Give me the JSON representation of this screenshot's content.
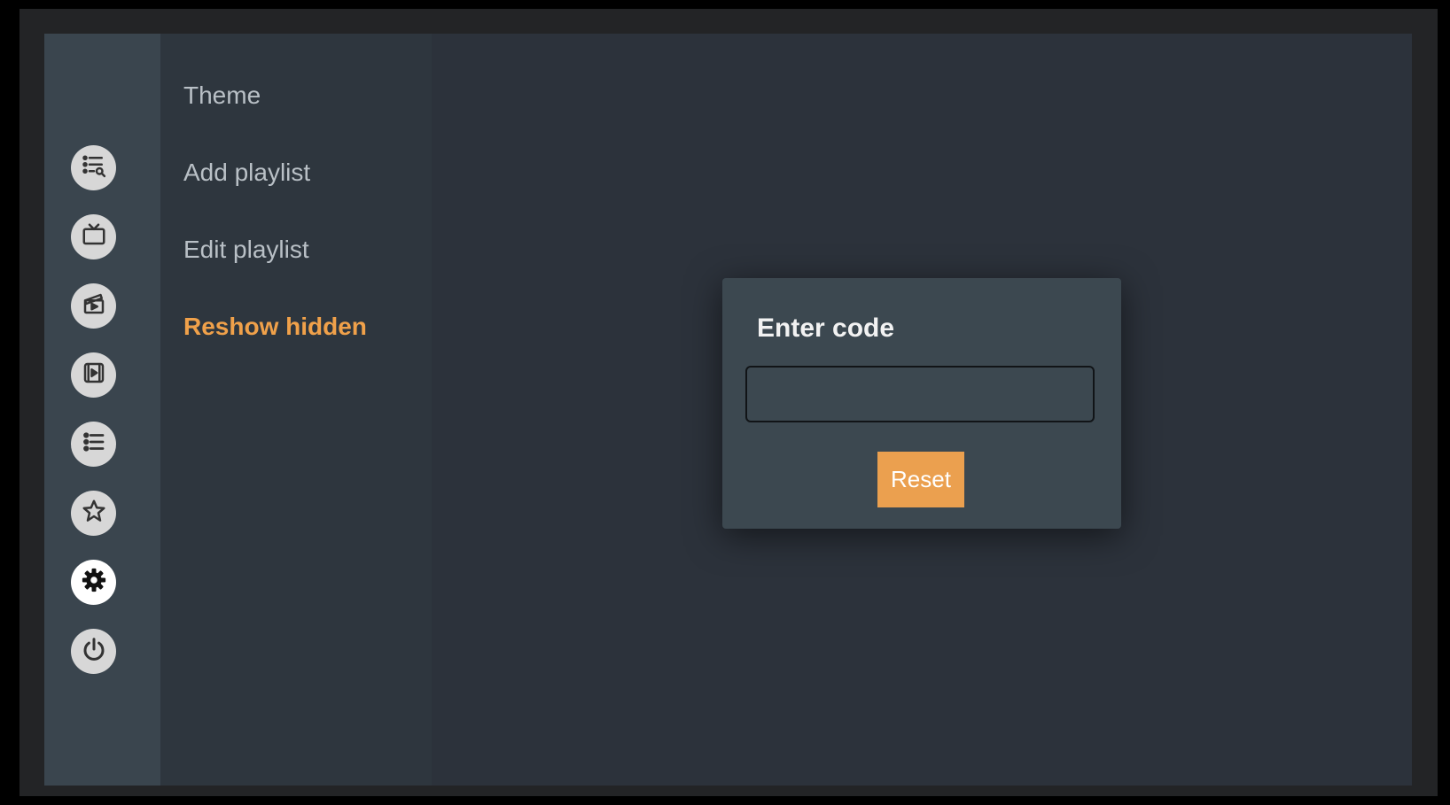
{
  "sidebar": {
    "icons": [
      {
        "name": "playlist-search-icon"
      },
      {
        "name": "live-tv-icon"
      },
      {
        "name": "movies-icon"
      },
      {
        "name": "series-icon"
      },
      {
        "name": "list-icon"
      },
      {
        "name": "favorites-star-icon"
      },
      {
        "name": "settings-gear-icon",
        "active": true
      },
      {
        "name": "power-icon"
      }
    ]
  },
  "menu": {
    "items": [
      {
        "label": "Theme"
      },
      {
        "label": "Add playlist"
      },
      {
        "label": "Edit playlist"
      },
      {
        "label": "Reshow hidden",
        "active": true
      }
    ]
  },
  "dialog": {
    "title": "Enter code",
    "input_value": "",
    "reset_label": "Reset"
  },
  "colors": {
    "accent": "#eba04f",
    "active_menu": "#f0a14a",
    "background": "#2c323b",
    "sidebar": "#3a454e"
  }
}
